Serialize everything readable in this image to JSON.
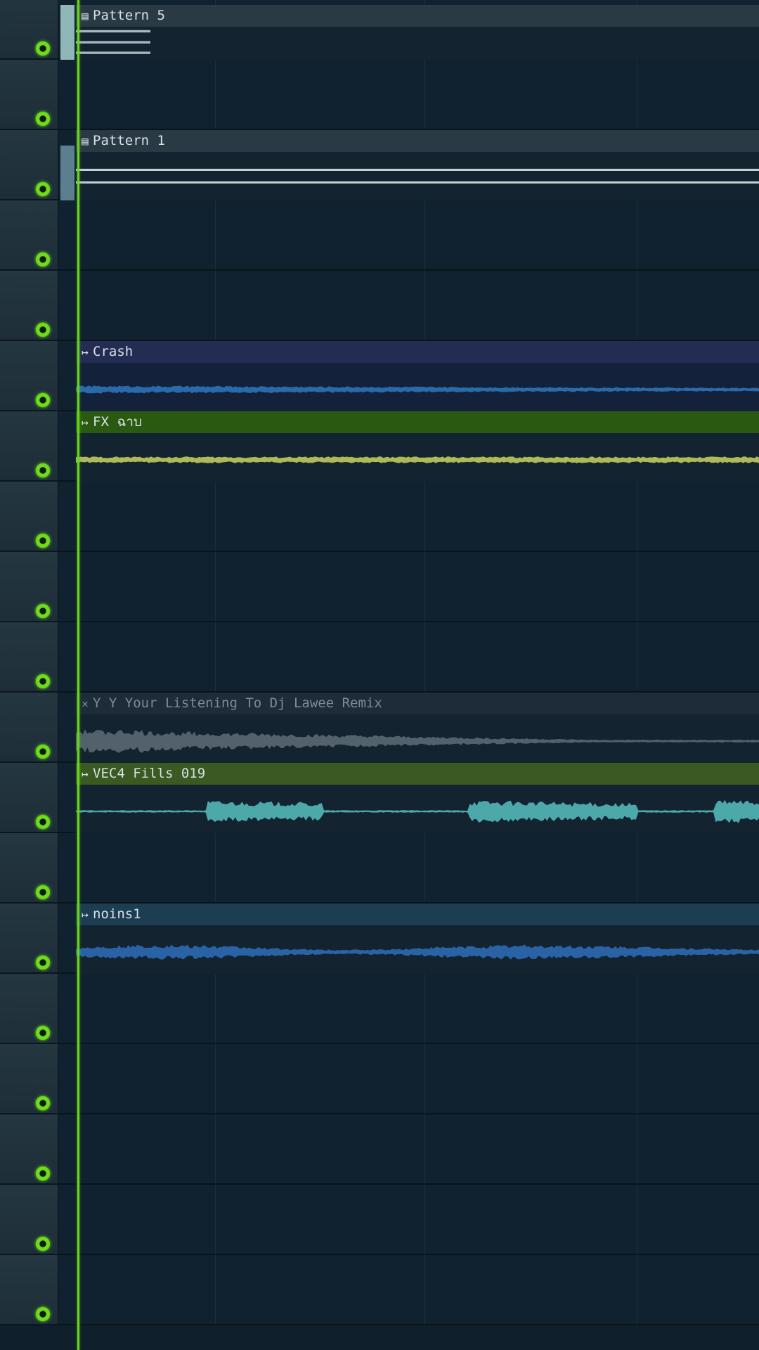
{
  "playlist": {
    "track_count": 19,
    "clips": [
      {
        "track": 0,
        "label": "Pattern 5",
        "icon": "pattern-icon",
        "kind": "pattern",
        "title_bg": "#2a3a44",
        "body_bg": "#132430",
        "wave_color": "#a9b7bf"
      },
      {
        "track": 2,
        "label": "Pattern 1",
        "icon": "pattern-icon",
        "kind": "pattern",
        "title_bg": "#2a3a44",
        "body_bg": "#132430",
        "wave_color": "#c5d0d5"
      },
      {
        "track": 5,
        "label": "Crash",
        "icon": "audio-clip-icon",
        "kind": "audio",
        "title_bg": "#232c52",
        "body_bg": "#13213a",
        "wave_color": "#2a6fb0"
      },
      {
        "track": 6,
        "label": "FX  ฉาบ",
        "icon": "audio-clip-icon",
        "kind": "audio",
        "title_bg": "#2a5a12",
        "body_bg": "#132430",
        "wave_color": "#b8c25a"
      },
      {
        "track": 10,
        "label": "Y Y Your Listening To Dj Lawee Remix",
        "icon": "muted-clip-icon",
        "kind": "audio-muted",
        "title_bg": "#1d2c38",
        "body_bg": "#132430",
        "wave_color": "#55656f",
        "title_color": "#7d8c94"
      },
      {
        "track": 11,
        "label": "VEC4 Fills 019",
        "icon": "audio-clip-icon",
        "kind": "audio",
        "title_bg": "#3a5a22",
        "body_bg": "#132430",
        "wave_color": "#4fb0b0"
      },
      {
        "track": 13,
        "label": "noins1",
        "icon": "audio-clip-icon",
        "kind": "audio",
        "title_bg": "#1c3d52",
        "body_bg": "#132430",
        "wave_color": "#2a67ad"
      }
    ]
  }
}
